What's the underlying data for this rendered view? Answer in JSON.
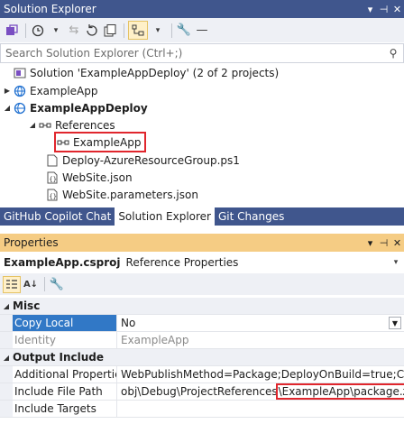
{
  "solution_explorer": {
    "title": "Solution Explorer",
    "search_placeholder": "Search Solution Explorer (Ctrl+;)",
    "tree": {
      "solution": "Solution 'ExampleAppDeploy' (2 of 2 projects)",
      "project1": "ExampleApp",
      "project2": "ExampleAppDeploy",
      "references": "References",
      "reference_item": "ExampleApp",
      "file1": "Deploy-AzureResourceGroup.ps1",
      "file2": "WebSite.json",
      "file3": "WebSite.parameters.json"
    },
    "tabs": [
      "GitHub Copilot Chat",
      "Solution Explorer",
      "Git Changes"
    ]
  },
  "properties": {
    "title": "Properties",
    "object_name": "ExampleApp.csproj",
    "object_type": "Reference Properties",
    "categories": {
      "misc": "Misc",
      "output": "Output Include"
    },
    "rows": {
      "copy_local": {
        "name": "Copy Local",
        "value": "No"
      },
      "identity": {
        "name": "Identity",
        "value": "ExampleApp"
      },
      "additional": {
        "name": "Additional Properties",
        "value": "WebPublishMethod=Package;DeployOnBuild=true;Configu"
      },
      "include_path": {
        "name": "Include File Path",
        "value_prefix": "obj\\Debug\\ProjectReferences",
        "value_highlight": "\\ExampleApp\\package.zip"
      },
      "include_targets": {
        "name": "Include Targets",
        "value": ""
      }
    }
  },
  "colors": {
    "accent": "#40568d",
    "properties_header": "#f5cc84",
    "highlight_box": "#e0262d",
    "selection": "#3178c6"
  }
}
